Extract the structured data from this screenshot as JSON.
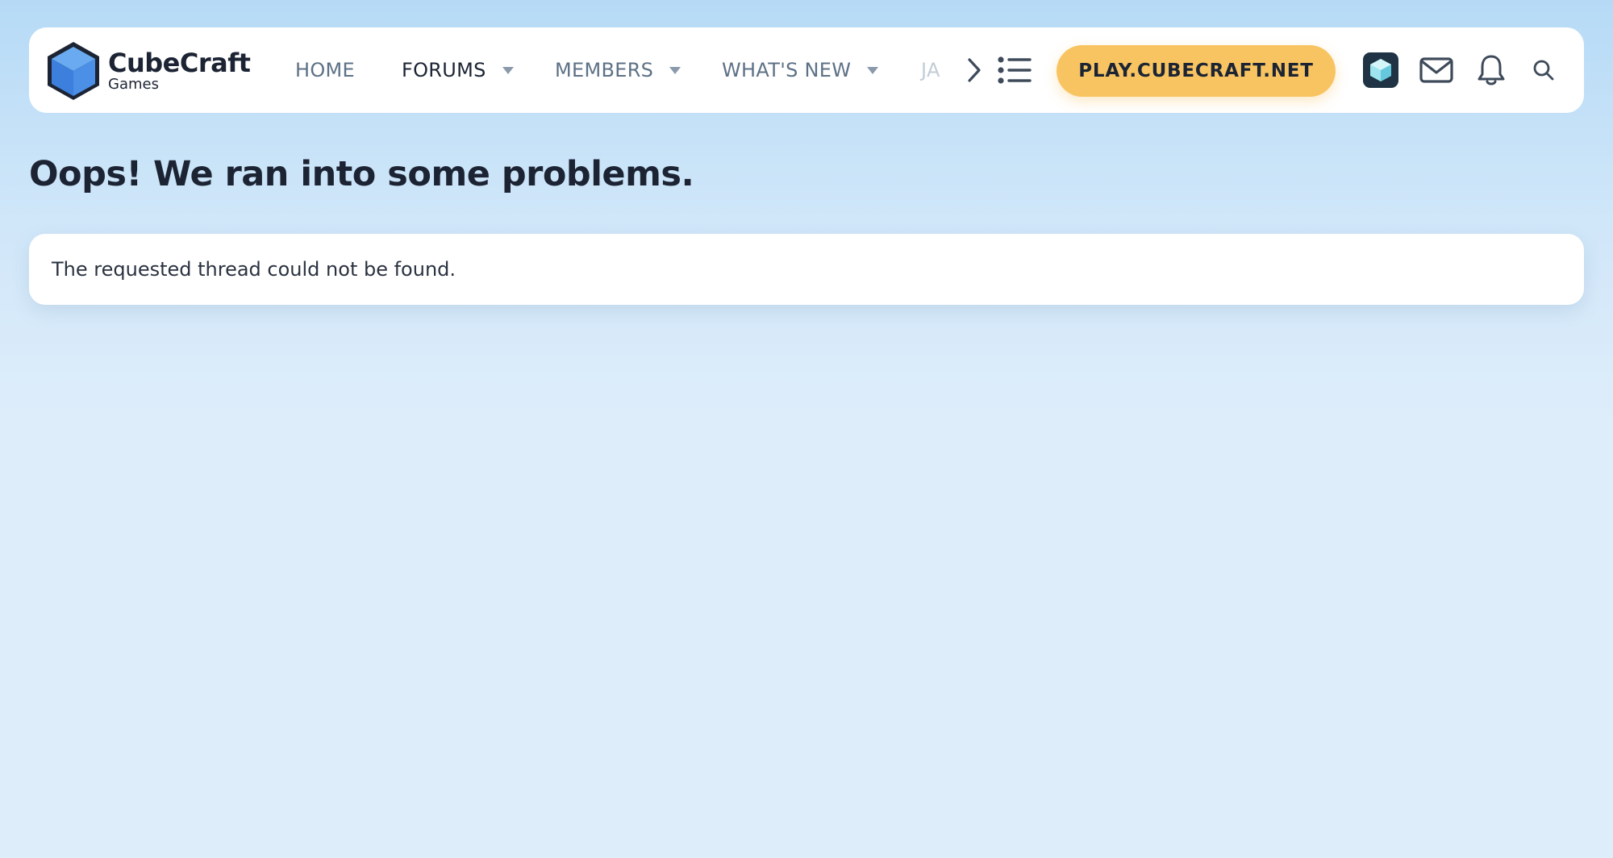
{
  "logo": {
    "name": "CubeCraft",
    "subtitle": "Games",
    "icon": "cube-logo-icon"
  },
  "nav": {
    "items": [
      {
        "label": "HOME",
        "has_dropdown": false,
        "active": false
      },
      {
        "label": "FORUMS",
        "has_dropdown": true,
        "active": true
      },
      {
        "label": "MEMBERS",
        "has_dropdown": true,
        "active": false
      },
      {
        "label": "WHAT'S NEW",
        "has_dropdown": true,
        "active": false
      },
      {
        "label": "JA",
        "has_dropdown": false,
        "active": false,
        "truncated": true
      }
    ],
    "scroll_icon": "chevron-right-icon",
    "menu_icon": "list-icon"
  },
  "play_button": {
    "label": "PLAY.CUBECRAFT.NET",
    "color": "#f8c461"
  },
  "toolbar_icons": [
    "avatar-cube-icon",
    "mail-icon",
    "bell-icon",
    "search-icon"
  ],
  "page": {
    "title": "Oops! We ran into some problems.",
    "message": "The requested thread could not be found."
  },
  "colors": {
    "background_top": "#b6daf6",
    "background_bottom": "#deedfa",
    "text_dark": "#1c2434",
    "nav_text": "#5d7186",
    "accent_blue": "#4a90e2"
  }
}
